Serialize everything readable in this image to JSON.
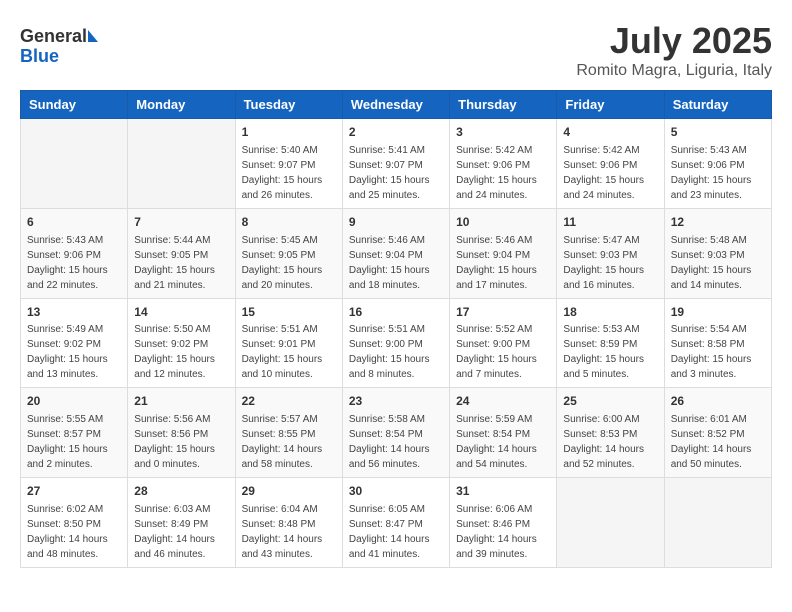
{
  "header": {
    "logo_general": "General",
    "logo_blue": "Blue",
    "month": "July 2025",
    "location": "Romito Magra, Liguria, Italy"
  },
  "weekdays": [
    "Sunday",
    "Monday",
    "Tuesday",
    "Wednesday",
    "Thursday",
    "Friday",
    "Saturday"
  ],
  "weeks": [
    [
      {
        "day": "",
        "info": ""
      },
      {
        "day": "",
        "info": ""
      },
      {
        "day": "1",
        "info": "Sunrise: 5:40 AM\nSunset: 9:07 PM\nDaylight: 15 hours\nand 26 minutes."
      },
      {
        "day": "2",
        "info": "Sunrise: 5:41 AM\nSunset: 9:07 PM\nDaylight: 15 hours\nand 25 minutes."
      },
      {
        "day": "3",
        "info": "Sunrise: 5:42 AM\nSunset: 9:06 PM\nDaylight: 15 hours\nand 24 minutes."
      },
      {
        "day": "4",
        "info": "Sunrise: 5:42 AM\nSunset: 9:06 PM\nDaylight: 15 hours\nand 24 minutes."
      },
      {
        "day": "5",
        "info": "Sunrise: 5:43 AM\nSunset: 9:06 PM\nDaylight: 15 hours\nand 23 minutes."
      }
    ],
    [
      {
        "day": "6",
        "info": "Sunrise: 5:43 AM\nSunset: 9:06 PM\nDaylight: 15 hours\nand 22 minutes."
      },
      {
        "day": "7",
        "info": "Sunrise: 5:44 AM\nSunset: 9:05 PM\nDaylight: 15 hours\nand 21 minutes."
      },
      {
        "day": "8",
        "info": "Sunrise: 5:45 AM\nSunset: 9:05 PM\nDaylight: 15 hours\nand 20 minutes."
      },
      {
        "day": "9",
        "info": "Sunrise: 5:46 AM\nSunset: 9:04 PM\nDaylight: 15 hours\nand 18 minutes."
      },
      {
        "day": "10",
        "info": "Sunrise: 5:46 AM\nSunset: 9:04 PM\nDaylight: 15 hours\nand 17 minutes."
      },
      {
        "day": "11",
        "info": "Sunrise: 5:47 AM\nSunset: 9:03 PM\nDaylight: 15 hours\nand 16 minutes."
      },
      {
        "day": "12",
        "info": "Sunrise: 5:48 AM\nSunset: 9:03 PM\nDaylight: 15 hours\nand 14 minutes."
      }
    ],
    [
      {
        "day": "13",
        "info": "Sunrise: 5:49 AM\nSunset: 9:02 PM\nDaylight: 15 hours\nand 13 minutes."
      },
      {
        "day": "14",
        "info": "Sunrise: 5:50 AM\nSunset: 9:02 PM\nDaylight: 15 hours\nand 12 minutes."
      },
      {
        "day": "15",
        "info": "Sunrise: 5:51 AM\nSunset: 9:01 PM\nDaylight: 15 hours\nand 10 minutes."
      },
      {
        "day": "16",
        "info": "Sunrise: 5:51 AM\nSunset: 9:00 PM\nDaylight: 15 hours\nand 8 minutes."
      },
      {
        "day": "17",
        "info": "Sunrise: 5:52 AM\nSunset: 9:00 PM\nDaylight: 15 hours\nand 7 minutes."
      },
      {
        "day": "18",
        "info": "Sunrise: 5:53 AM\nSunset: 8:59 PM\nDaylight: 15 hours\nand 5 minutes."
      },
      {
        "day": "19",
        "info": "Sunrise: 5:54 AM\nSunset: 8:58 PM\nDaylight: 15 hours\nand 3 minutes."
      }
    ],
    [
      {
        "day": "20",
        "info": "Sunrise: 5:55 AM\nSunset: 8:57 PM\nDaylight: 15 hours\nand 2 minutes."
      },
      {
        "day": "21",
        "info": "Sunrise: 5:56 AM\nSunset: 8:56 PM\nDaylight: 15 hours\nand 0 minutes."
      },
      {
        "day": "22",
        "info": "Sunrise: 5:57 AM\nSunset: 8:55 PM\nDaylight: 14 hours\nand 58 minutes."
      },
      {
        "day": "23",
        "info": "Sunrise: 5:58 AM\nSunset: 8:54 PM\nDaylight: 14 hours\nand 56 minutes."
      },
      {
        "day": "24",
        "info": "Sunrise: 5:59 AM\nSunset: 8:54 PM\nDaylight: 14 hours\nand 54 minutes."
      },
      {
        "day": "25",
        "info": "Sunrise: 6:00 AM\nSunset: 8:53 PM\nDaylight: 14 hours\nand 52 minutes."
      },
      {
        "day": "26",
        "info": "Sunrise: 6:01 AM\nSunset: 8:52 PM\nDaylight: 14 hours\nand 50 minutes."
      }
    ],
    [
      {
        "day": "27",
        "info": "Sunrise: 6:02 AM\nSunset: 8:50 PM\nDaylight: 14 hours\nand 48 minutes."
      },
      {
        "day": "28",
        "info": "Sunrise: 6:03 AM\nSunset: 8:49 PM\nDaylight: 14 hours\nand 46 minutes."
      },
      {
        "day": "29",
        "info": "Sunrise: 6:04 AM\nSunset: 8:48 PM\nDaylight: 14 hours\nand 43 minutes."
      },
      {
        "day": "30",
        "info": "Sunrise: 6:05 AM\nSunset: 8:47 PM\nDaylight: 14 hours\nand 41 minutes."
      },
      {
        "day": "31",
        "info": "Sunrise: 6:06 AM\nSunset: 8:46 PM\nDaylight: 14 hours\nand 39 minutes."
      },
      {
        "day": "",
        "info": ""
      },
      {
        "day": "",
        "info": ""
      }
    ]
  ]
}
